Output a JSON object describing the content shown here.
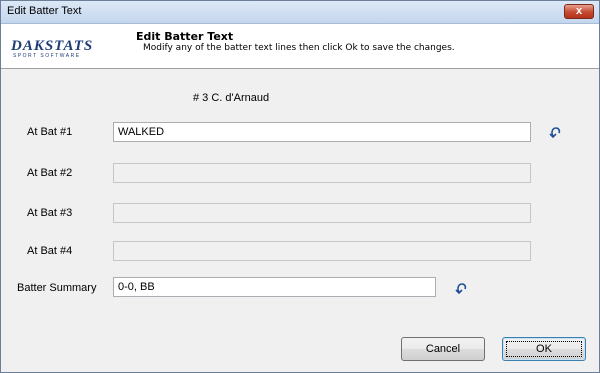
{
  "window": {
    "title": "Edit Batter Text",
    "close_label": "x"
  },
  "header": {
    "logo_text": "DAKSTATS",
    "logo_tagline": "SPORT SOFTWARE",
    "title": "Edit Batter Text",
    "subtitle": "Modify any of the batter text lines then click Ok to save the changes."
  },
  "batter": {
    "name": "# 3 C. d'Arnaud"
  },
  "at_bats": [
    {
      "label": "At Bat #1",
      "value": "WALKED"
    },
    {
      "label": "At Bat #2",
      "value": ""
    },
    {
      "label": "At Bat #3",
      "value": ""
    },
    {
      "label": "At Bat #4",
      "value": ""
    }
  ],
  "summary": {
    "label": "Batter Summary",
    "value": "0-0, BB"
  },
  "buttons": {
    "cancel": "Cancel",
    "ok": "OK"
  },
  "colors": {
    "logo": "#1e3c78",
    "undo_icon": "#1f4f96",
    "close_button": "#c54a30"
  },
  "icons": {
    "undo": "undo-icon"
  }
}
